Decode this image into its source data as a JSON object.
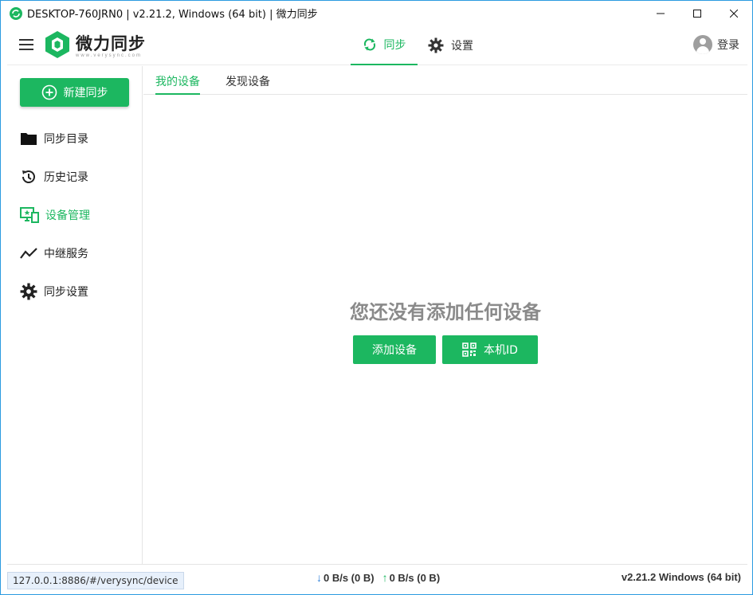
{
  "window": {
    "title": "DESKTOP-760JRN0 | v2.21.2, Windows (64 bit) | 微力同步",
    "minimize": "─",
    "maximize": "☐",
    "close": "✕"
  },
  "header": {
    "logo_name": "微力同步",
    "logo_sub": "www.verysync.com",
    "tabs": [
      {
        "label": "同步",
        "icon": "sync-icon",
        "active": true
      },
      {
        "label": "设置",
        "icon": "gear-icon",
        "active": false
      }
    ],
    "login_label": "登录"
  },
  "sidebar": {
    "new_sync_label": "新建同步",
    "items": [
      {
        "label": "同步目录",
        "icon": "folder-icon",
        "active": false
      },
      {
        "label": "历史记录",
        "icon": "history-icon",
        "active": false
      },
      {
        "label": "设备管理",
        "icon": "device-icon",
        "active": true
      },
      {
        "label": "中继服务",
        "icon": "relay-icon",
        "active": false
      },
      {
        "label": "同步设置",
        "icon": "gear-icon",
        "active": false
      }
    ]
  },
  "main": {
    "subtabs": [
      {
        "label": "我的设备",
        "active": true
      },
      {
        "label": "发现设备",
        "active": false
      }
    ],
    "empty_message": "您还没有添加任何设备",
    "add_device_label": "添加设备",
    "my_id_label": "本机ID"
  },
  "statusbar": {
    "download": "0 B/s (0 B)",
    "upload": "0 B/s (0 B)",
    "version": "v2.21.2  Windows (64 bit)",
    "url_tooltip": "127.0.0.1:8886/#/verysync/device"
  },
  "colors": {
    "accent": "#1cb760",
    "download_arrow": "#2e7fd8",
    "window_border": "#2b9be0"
  }
}
